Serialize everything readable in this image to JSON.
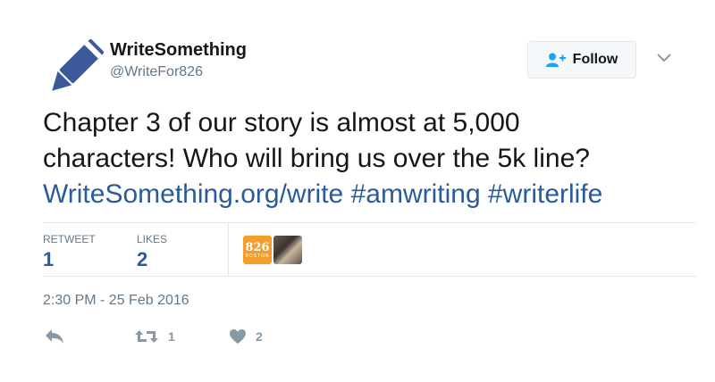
{
  "author": {
    "name": "WriteSomething",
    "handle": "@WriteFor826",
    "avatar_icon": "pencil-icon"
  },
  "follow_button": {
    "label": "Follow",
    "icon": "add-user-icon"
  },
  "tweet": {
    "text_line1": "Chapter 3 of our story is almost at 5,000",
    "text_line2": "characters! Who will bring us over the 5k line?",
    "link": "WriteSomething.org/write",
    "hashtag1": "#amwriting",
    "hashtag2": "#writerlife"
  },
  "stats": {
    "retweet_label": "RETWEET",
    "retweet_count": "1",
    "likes_label": "LIKES",
    "likes_count": "2",
    "liker_badge_big": "826",
    "liker_badge_small": "BOSTON"
  },
  "timestamp": "2:30 PM - 25 Feb 2016",
  "actions": {
    "retweet_count": "1",
    "like_count": "2"
  },
  "colors": {
    "link": "#2b5b9b",
    "muted": "#8899a6",
    "avatar": "#3b5998"
  }
}
